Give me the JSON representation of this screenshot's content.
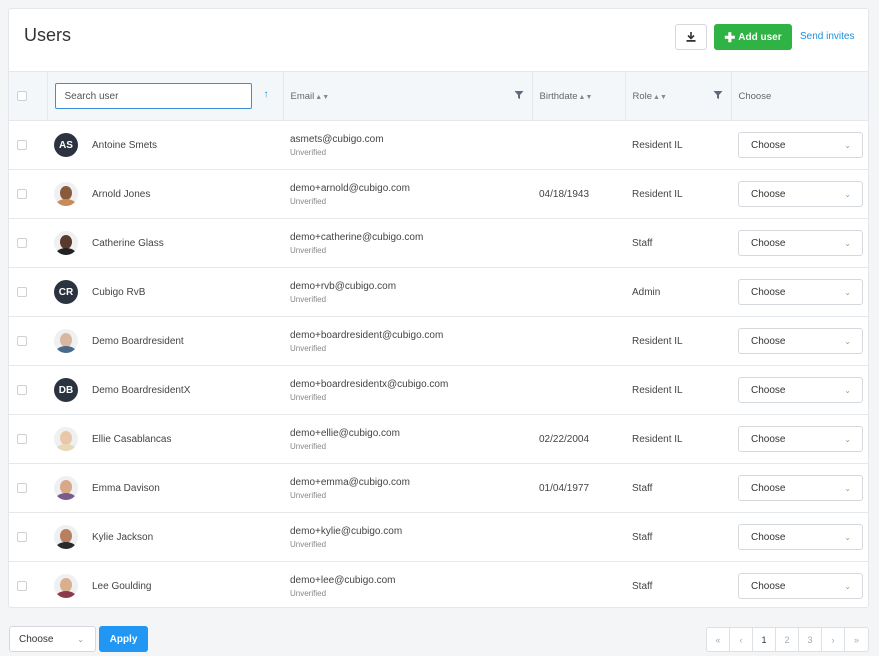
{
  "header": {
    "title": "Users",
    "add_label": "Add user",
    "send_label": "Send invites"
  },
  "search": {
    "placeholder": "Search user"
  },
  "columns": {
    "email": "Email",
    "birthdate": "Birthdate",
    "role": "Role",
    "choose": "Choose"
  },
  "users": [
    {
      "name": "Antoine Smets",
      "initials": "AS",
      "email": "asmets@cubigo.com",
      "status": "Unverified",
      "birthdate": "",
      "role": "Resident IL",
      "choose": "Choose"
    },
    {
      "name": "Arnold Jones",
      "initials": "",
      "email": "demo+arnold@cubigo.com",
      "status": "Unverified",
      "birthdate": "04/18/1943",
      "role": "Resident IL",
      "choose": "Choose"
    },
    {
      "name": "Catherine Glass",
      "initials": "",
      "email": "demo+catherine@cubigo.com",
      "status": "Unverified",
      "birthdate": "",
      "role": "Staff",
      "choose": "Choose"
    },
    {
      "name": "Cubigo RvB",
      "initials": "CR",
      "email": "demo+rvb@cubigo.com",
      "status": "Unverified",
      "birthdate": "",
      "role": "Admin",
      "choose": "Choose"
    },
    {
      "name": "Demo Boardresident",
      "initials": "",
      "email": "demo+boardresident@cubigo.com",
      "status": "Unverified",
      "birthdate": "",
      "role": "Resident IL",
      "choose": "Choose"
    },
    {
      "name": "Demo BoardresidentX",
      "initials": "DB",
      "email": "demo+boardresidentx@cubigo.com",
      "status": "Unverified",
      "birthdate": "",
      "role": "Resident IL",
      "choose": "Choose"
    },
    {
      "name": "Ellie Casablancas",
      "initials": "",
      "email": "demo+ellie@cubigo.com",
      "status": "Unverified",
      "birthdate": "02/22/2004",
      "role": "Resident IL",
      "choose": "Choose"
    },
    {
      "name": "Emma Davison",
      "initials": "",
      "email": "demo+emma@cubigo.com",
      "status": "Unverified",
      "birthdate": "01/04/1977",
      "role": "Staff",
      "choose": "Choose"
    },
    {
      "name": "Kylie Jackson",
      "initials": "",
      "email": "demo+kylie@cubigo.com",
      "status": "Unverified",
      "birthdate": "",
      "role": "Staff",
      "choose": "Choose"
    },
    {
      "name": "Lee Goulding",
      "initials": "",
      "email": "demo+lee@cubigo.com",
      "status": "Unverified",
      "birthdate": "",
      "role": "Staff",
      "choose": "Choose"
    }
  ],
  "footer": {
    "bulk_select": "Choose",
    "apply_label": "Apply",
    "pages": [
      "1",
      "2",
      "3"
    ],
    "current_page": "1"
  },
  "colors": {
    "primary": "#2196f3",
    "success": "#2fb344",
    "link": "#1a8fdd",
    "avatar_dark": "#2c3340"
  }
}
